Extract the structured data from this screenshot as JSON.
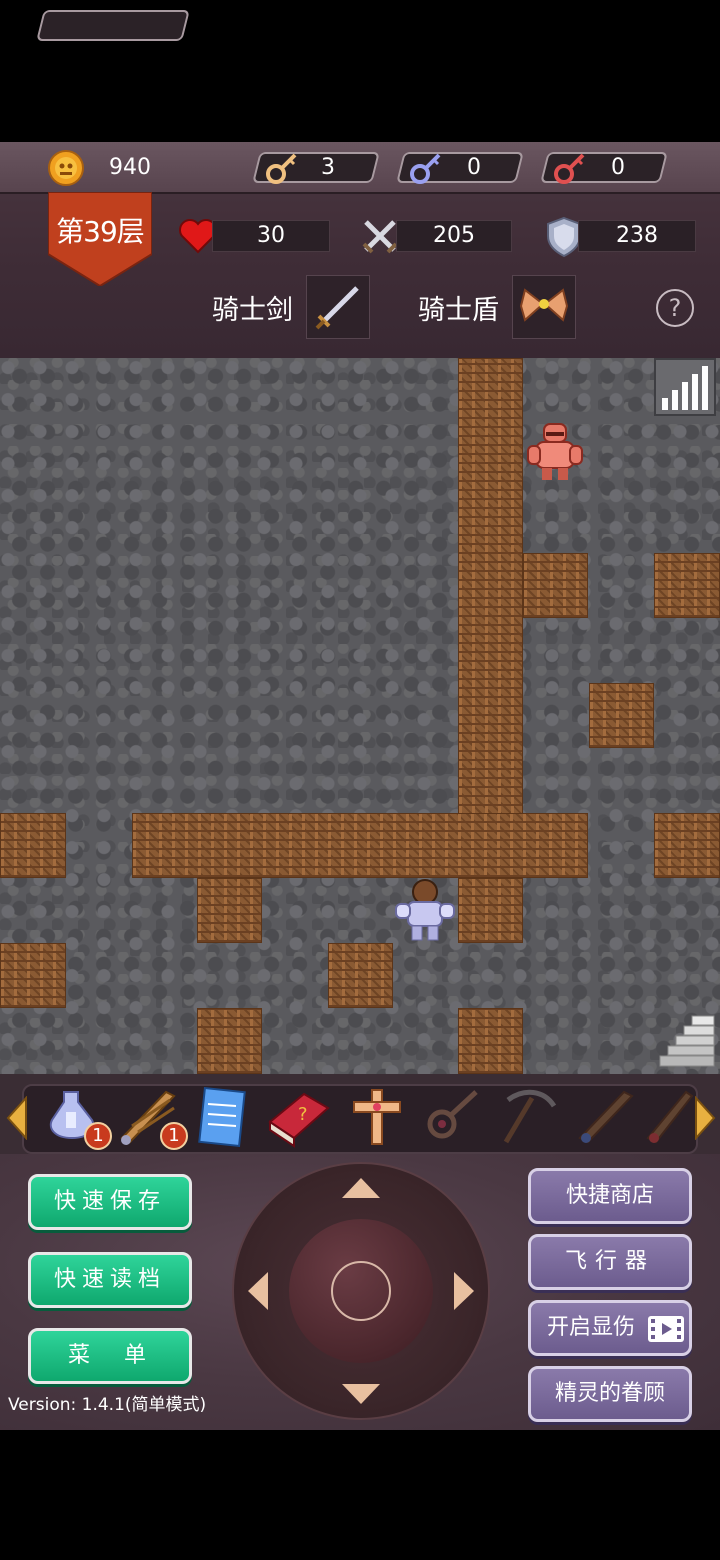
{
  "resources": {
    "gold": "940",
    "yellow_keys": "3",
    "blue_keys": "0",
    "red_keys": "0"
  },
  "floor": {
    "label": "第39层"
  },
  "stats": {
    "hp": "30",
    "attack": "205",
    "defense": "238"
  },
  "equipment": {
    "weapon_label": "骑士剑",
    "armor_label": "骑士盾"
  },
  "help": {
    "glyph": "?"
  },
  "toolbar": {
    "items": [
      {
        "name": "holy-water-icon",
        "badge": "1"
      },
      {
        "name": "pickaxe-wing-icon",
        "badge": "1"
      },
      {
        "name": "notepad-icon"
      },
      {
        "name": "monster-book-icon"
      },
      {
        "name": "cross-icon"
      },
      {
        "name": "key-icon"
      },
      {
        "name": "pickaxe-icon"
      },
      {
        "name": "wing-down-icon"
      },
      {
        "name": "wing-up-icon"
      }
    ]
  },
  "buttons": {
    "quick_save": "快速保存",
    "quick_load": "快速读档",
    "menu": "菜　单",
    "quick_shop": "快捷商店",
    "flyer": "飞行器",
    "show_damage": "开启显伤",
    "spirit_favor": "精灵的眷顾"
  },
  "version": "Version: 1.4.1(简单模式)",
  "colors": {
    "green_button": "#1bbf84",
    "purple_button": "#7b6b9c",
    "floor_banner": "#c0401e"
  }
}
